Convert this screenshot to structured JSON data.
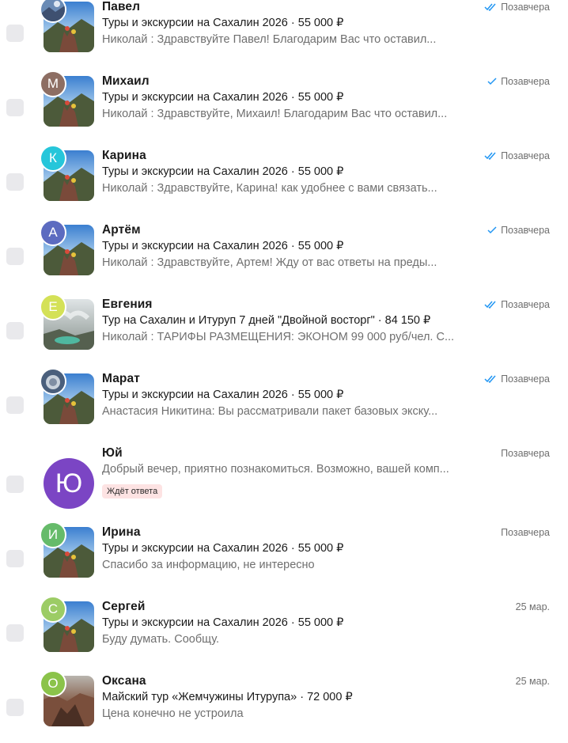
{
  "conversations": [
    {
      "name": "Павел",
      "avatar_initial": "",
      "avatar_color": "#6a8bb5",
      "listing": "Туры и экскурсии на Сахалин 2026 · 55 000 ₽",
      "preview": "Николай : Здравствуйте Павел! Благодарим Вас что оставил...",
      "date": "Позавчера",
      "status": "read"
    },
    {
      "name": "Михаил",
      "avatar_initial": "М",
      "avatar_color": "#8d6e63",
      "listing": "Туры и экскурсии на Сахалин 2026 · 55 000 ₽",
      "preview": "Николай : Здравствуйте, Михаил! Благодарим Вас что оставил...",
      "date": "Позавчера",
      "status": "sent"
    },
    {
      "name": "Карина",
      "avatar_initial": "К",
      "avatar_color": "#26c6da",
      "listing": "Туры и экскурсии на Сахалин 2026 · 55 000 ₽",
      "preview": "Николай : Здравствуйте, Карина! как удобнее с вами связать...",
      "date": "Позавчера",
      "status": "read"
    },
    {
      "name": "Артём",
      "avatar_initial": "А",
      "avatar_color": "#5c6bc0",
      "listing": "Туры и экскурсии на Сахалин 2026 · 55 000 ₽",
      "preview": "Николай : Здравствуйте, Артем! Жду от вас ответы на преды...",
      "date": "Позавчера",
      "status": "sent"
    },
    {
      "name": "Евгения",
      "avatar_initial": "Е",
      "avatar_color": "#d4e157",
      "listing": "Тур на Сахалин и Итуруп 7 дней \"Двойной восторг\" · 84 150 ₽",
      "preview": "Николай : ТАРИФЫ РАЗМЕЩЕНИЯ: ЭКОНОМ 99 000 руб/чел. С...",
      "date": "Позавчера",
      "status": "read"
    },
    {
      "name": "Марат",
      "avatar_initial": "",
      "avatar_color": "#4a5f7c",
      "listing": "Туры и экскурсии на Сахалин 2026 · 55 000 ₽",
      "preview": "Анастасия Никитина: Вы рассматривали пакет базовых экску...",
      "date": "Позавчера",
      "status": "read"
    },
    {
      "name": "Юй",
      "avatar_initial": "Ю",
      "avatar_color": "#7b45c4",
      "listing": "",
      "preview": "Добрый вечер, приятно познакомиться. Возможно, вашей комп...",
      "date": "Позавчера",
      "status": "",
      "badge": "Ждёт ответа"
    },
    {
      "name": "Ирина",
      "avatar_initial": "И",
      "avatar_color": "#66bb6a",
      "listing": "Туры и экскурсии на Сахалин 2026 · 55 000 ₽",
      "preview": "Спасибо за информацию, не интересно",
      "date": "Позавчера",
      "status": ""
    },
    {
      "name": "Сергей",
      "avatar_initial": "С",
      "avatar_color": "#9ccc65",
      "listing": "Туры и экскурсии на Сахалин 2026 · 55 000 ₽",
      "preview": "Буду думать. Сообщу.",
      "date": "25 мар.",
      "status": ""
    },
    {
      "name": "Оксана",
      "avatar_initial": "О",
      "avatar_color": "#8bc34a",
      "listing": "Майский тур «Жемчужины Итурупа» · 72 000 ₽",
      "preview": "Цена конечно не устроила",
      "date": "25 мар.",
      "status": ""
    }
  ],
  "colors": {
    "check_read": "#2196f3",
    "check_sent": "#2196f3",
    "badge_bg": "#fde3e3"
  }
}
